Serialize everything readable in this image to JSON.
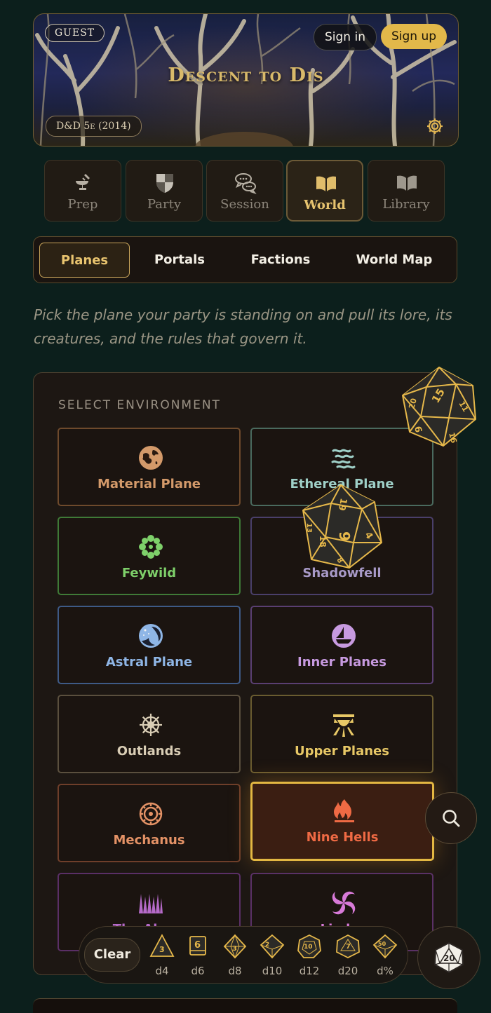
{
  "header": {
    "guest_badge": "GUEST",
    "sign_in": "Sign in",
    "sign_up": "Sign up",
    "campaign_title": "Descent to Dis",
    "edition": "D&D 5e (2014)",
    "settings_icon": "gear-icon"
  },
  "main_tabs": [
    {
      "label": "Prep",
      "icon": "anvil-icon",
      "active": false
    },
    {
      "label": "Party",
      "icon": "shield-icon",
      "active": false
    },
    {
      "label": "Session",
      "icon": "chat-bubbles-icon",
      "active": false
    },
    {
      "label": "World",
      "icon": "open-book-icon",
      "active": true
    },
    {
      "label": "Library",
      "icon": "book-icon",
      "active": false
    }
  ],
  "sub_tabs": [
    {
      "label": "Planes",
      "active": true
    },
    {
      "label": "Portals",
      "active": false
    },
    {
      "label": "Factions",
      "active": false
    },
    {
      "label": "World Map",
      "active": false
    }
  ],
  "intro_text": "Pick the plane your party is standing on and pull its lore, its creatures, and the rules that govern it.",
  "environment_panel": {
    "heading": "SELECT ENVIRONMENT",
    "environments": [
      {
        "label": "Material Plane",
        "icon": "globe-icon",
        "color": "#d49a6a",
        "border": "#6e4a2c",
        "selected": false
      },
      {
        "label": "Ethereal Plane",
        "icon": "mist-icon",
        "color": "#9fd0c8",
        "border": "#4a6a5e",
        "selected": false
      },
      {
        "label": "Feywild",
        "icon": "flower-icon",
        "color": "#7ed06a",
        "border": "#3f7a37",
        "selected": false
      },
      {
        "label": "Shadowfell",
        "icon": "shadow-icon",
        "color": "#a89ac8",
        "border": "#4a3f6a",
        "selected": false
      },
      {
        "label": "Astral Plane",
        "icon": "starry-moon-icon",
        "color": "#8fb6e6",
        "border": "#3e5a86",
        "selected": false
      },
      {
        "label": "Inner Planes",
        "icon": "elemental-orb-icon",
        "color": "#c79ae0",
        "border": "#5a3f72",
        "selected": false
      },
      {
        "label": "Outlands",
        "icon": "wheel-icon",
        "color": "#d9cdb5",
        "border": "#5a4f3e",
        "selected": false
      },
      {
        "label": "Upper Planes",
        "icon": "radiant-sun-icon",
        "color": "#e8c866",
        "border": "#6a5c30",
        "selected": false
      },
      {
        "label": "Mechanus",
        "icon": "gears-icon",
        "color": "#e49266",
        "border": "#6e3e2a",
        "selected": false
      },
      {
        "label": "Nine Hells",
        "icon": "hellfire-icon",
        "color": "#ef6a44",
        "border": "#e3b742",
        "selected": true
      },
      {
        "label": "The Abyss",
        "icon": "spikes-icon",
        "color": "#b56ac8",
        "border": "#5a2f66",
        "selected": false
      },
      {
        "label": "Limbo",
        "icon": "swirl-icon",
        "color": "#d77ad8",
        "border": "#5a3166",
        "selected": false
      }
    ]
  },
  "floating": {
    "search_icon": "search-icon",
    "d20_numbers_top": [
      "15",
      "11",
      "20",
      "16",
      "9"
    ],
    "d20_numbers_mid": [
      "19",
      "9",
      "4",
      "18",
      "13",
      "8"
    ]
  },
  "dice_tray": {
    "clear": "Clear",
    "dice": [
      {
        "label": "d4",
        "face": "3"
      },
      {
        "label": "d6",
        "face": "6"
      },
      {
        "label": "d8",
        "face": "3"
      },
      {
        "label": "d10",
        "face": "2"
      },
      {
        "label": "d12",
        "face": "10"
      },
      {
        "label": "d20",
        "face": "7"
      },
      {
        "label": "d%",
        "face": "50"
      }
    ],
    "roll_face": "20"
  }
}
